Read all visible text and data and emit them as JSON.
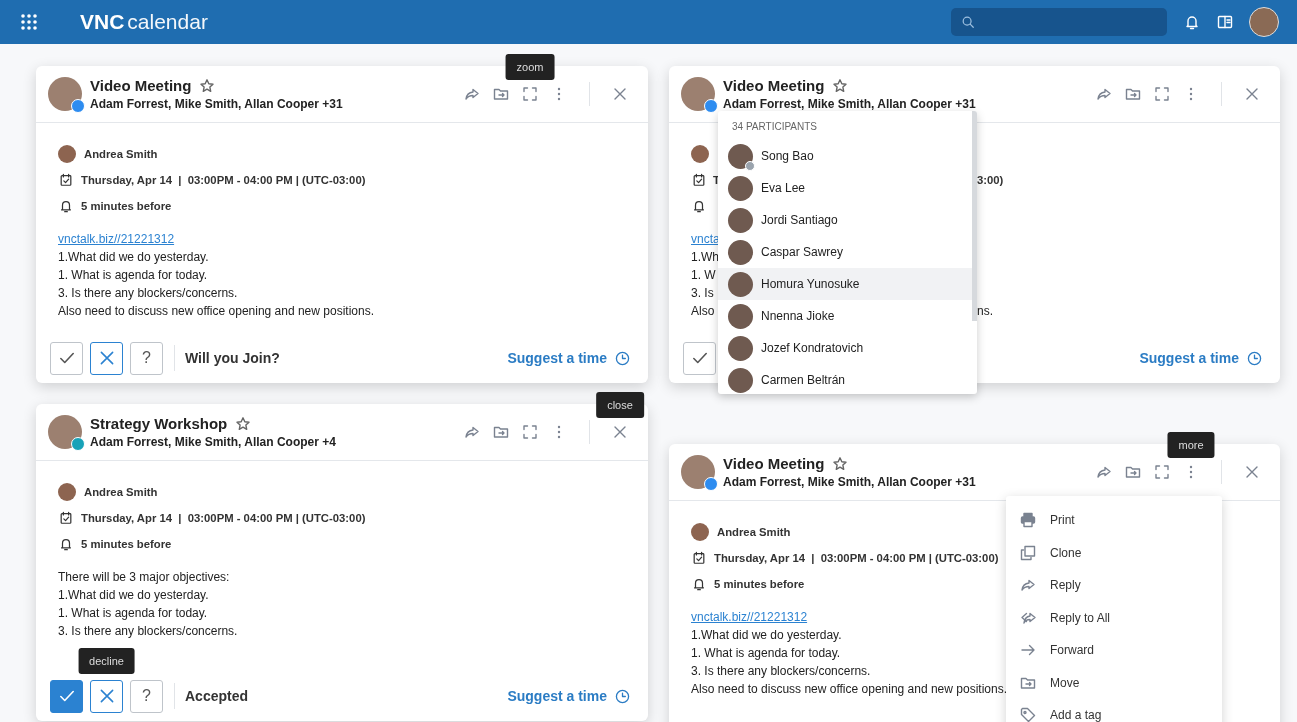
{
  "app_bar": {
    "logo_bold": "VNC",
    "logo_light": "calendar"
  },
  "cards": [
    {
      "title": "Video Meeting",
      "starred": false,
      "badge": {
        "kind": "video"
      },
      "participants_summary": "Adam Forrest, Mike Smith, Allan Cooper +31",
      "actions": [
        {
          "kind": "share"
        },
        {
          "kind": "folder"
        },
        {
          "kind": "zoom",
          "tooltip": "zoom"
        },
        {
          "kind": "more"
        },
        {
          "kind": "close"
        }
      ],
      "organizer": "Andrea Smith",
      "when": "Thursday, Apr 14  |  03:00PM - 04:00 PM | (UTC-03:00)",
      "reminder": "5 minutes before",
      "link": "vnctalk.biz//21221312",
      "description": [
        "1.What did we do yesterday.",
        "1. What is agenda for today.",
        "3. Is there any blockers/concerns.",
        "Also need to discuss new office opening and new positions."
      ],
      "footer": {
        "buttons": [
          {
            "kind": "accept",
            "selected": false,
            "focused": false
          },
          {
            "kind": "decline",
            "selected": false,
            "focused": true
          },
          {
            "kind": "maybe",
            "label": "?",
            "selected": false,
            "focused": false
          }
        ],
        "status": "Will you Join?",
        "suggest": "Suggest a time"
      }
    },
    {
      "title": "Video Meeting",
      "starred": false,
      "badge": {
        "kind": "video"
      },
      "participants_summary": "Adam Forrest, Mike Smith, Allan Cooper +31",
      "actions": [
        {
          "kind": "share"
        },
        {
          "kind": "folder"
        },
        {
          "kind": "zoom"
        },
        {
          "kind": "more"
        },
        {
          "kind": "close"
        }
      ],
      "covered_rows": [
        {
          "kind": "organizer"
        },
        {
          "kind": "when",
          "start": "T",
          "end": "3:00)"
        },
        {
          "kind": "reminder"
        },
        {
          "kind": "link",
          "start": "vncta"
        },
        {
          "kind": "text",
          "start": "1.Wh"
        },
        {
          "kind": "text",
          "start": "1. W"
        },
        {
          "kind": "text",
          "start": "3. Is"
        },
        {
          "kind": "text",
          "start": "Also",
          "end": "ns."
        }
      ],
      "footer": {
        "buttons": [
          {
            "kind": "accept",
            "selected": false,
            "focused": false
          }
        ],
        "suggest": "Suggest a time"
      },
      "participants_popup": {
        "heading": "34 PARTICIPANTS",
        "items": [
          {
            "name": "Song Bao",
            "status_badge": true,
            "hovered": false
          },
          {
            "name": "Eva Lee",
            "status_badge": false,
            "hovered": false
          },
          {
            "name": "Jordi Santiago",
            "status_badge": false,
            "hovered": false
          },
          {
            "name": "Caspar Sawrey",
            "status_badge": false,
            "hovered": false
          },
          {
            "name": "Homura Yunosuke",
            "status_badge": false,
            "hovered": true
          },
          {
            "name": "Nnenna Jioke",
            "status_badge": false,
            "hovered": false
          },
          {
            "name": "Jozef Kondratovich",
            "status_badge": false,
            "hovered": false
          },
          {
            "name": "Carmen Beltrán",
            "status_badge": false,
            "hovered": false
          }
        ]
      }
    },
    {
      "title": "Strategy Workshop",
      "starred": false,
      "badge": {
        "kind": "calendar"
      },
      "participants_summary": "Adam Forrest, Mike Smith, Allan Cooper +4",
      "actions": [
        {
          "kind": "share"
        },
        {
          "kind": "folder"
        },
        {
          "kind": "zoom"
        },
        {
          "kind": "more"
        },
        {
          "kind": "close",
          "tooltip": "close"
        }
      ],
      "organizer": "Andrea Smith",
      "when": "Thursday, Apr 14  |  03:00PM - 04:00 PM | (UTC-03:00)",
      "reminder": "5 minutes before",
      "description": [
        "There will be 3 major objectives:",
        "1.What did we do yesterday.",
        "1. What is agenda for today.",
        "3. Is there any blockers/concerns."
      ],
      "footer": {
        "buttons": [
          {
            "kind": "accept",
            "selected": true
          },
          {
            "kind": "decline",
            "selected": false,
            "focused": true,
            "tooltip": "decline"
          },
          {
            "kind": "maybe",
            "label": "?",
            "selected": false,
            "focused": false
          }
        ],
        "status": "Accepted",
        "suggest": "Suggest a time"
      }
    },
    {
      "title": "Video Meeting",
      "starred": false,
      "badge": {
        "kind": "video"
      },
      "participants_summary": "Adam Forrest, Mike Smith, Allan Cooper +31",
      "actions": [
        {
          "kind": "share"
        },
        {
          "kind": "folder"
        },
        {
          "kind": "zoom"
        },
        {
          "kind": "more",
          "tooltip": "more"
        },
        {
          "kind": "close"
        }
      ],
      "organizer": "Andrea Smith",
      "when": "Thursday, Apr 14  |  03:00PM - 04:00 PM | (UTC-03:00)",
      "reminder": "5 minutes before",
      "link": "vnctalk.biz//21221312",
      "description": [
        "1.What did we do yesterday.",
        "1. What is agenda for today.",
        "3. Is there any blockers/concerns.",
        "Also need to discuss new office opening and new positions."
      ],
      "more_menu": [
        {
          "kind": "print",
          "label": "Print"
        },
        {
          "kind": "clone",
          "label": "Clone"
        },
        {
          "kind": "reply",
          "label": "Reply"
        },
        {
          "kind": "reply_all",
          "label": "Reply to All"
        },
        {
          "kind": "forward",
          "label": "Forward"
        },
        {
          "kind": "move",
          "label": "Move"
        },
        {
          "kind": "tag",
          "label": "Add a tag"
        }
      ]
    }
  ]
}
